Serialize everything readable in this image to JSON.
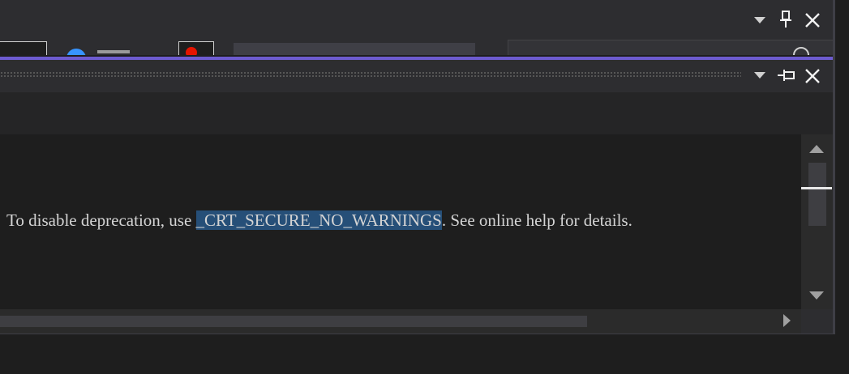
{
  "output": {
    "text_before": "To disable deprecation, use ",
    "selected_text": "_CRT_SECURE_NO_WARNINGS",
    "text_after": ". See online help for details."
  },
  "icons": {
    "outer_dropdown": "chevron-down-icon",
    "outer_pin": "pin-icon",
    "outer_close": "close-icon",
    "inner_dropdown": "chevron-down-icon",
    "inner_pin": "pin-horizontal-icon",
    "inner_close": "close-icon",
    "scroll_up": "scroll-up-arrow-icon",
    "scroll_down": "scroll-down-arrow-icon",
    "scroll_right": "scroll-right-arrow-icon"
  },
  "colors": {
    "selection": "#264f78",
    "accent": "#6d5bd0",
    "background": "#1e1e1e"
  }
}
